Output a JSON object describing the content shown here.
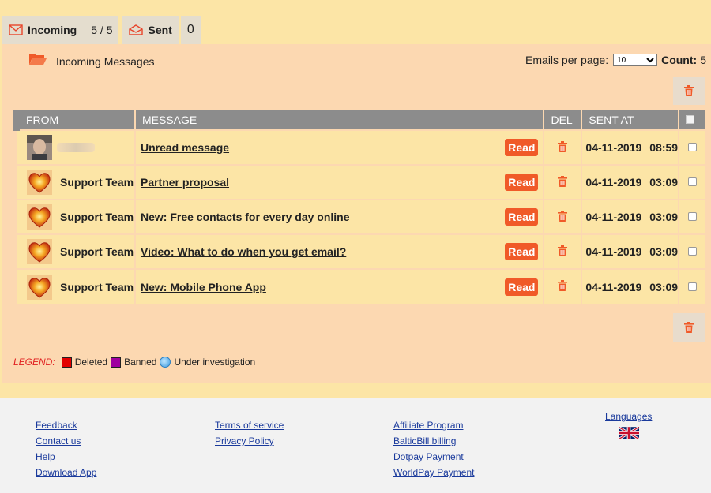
{
  "tabs": {
    "incoming": {
      "label": "Incoming",
      "count": "5 / 5"
    },
    "sent": {
      "label": "Sent",
      "count": "0"
    }
  },
  "panel": {
    "title": "Incoming Messages",
    "emails_per_page_label": "Emails per page:",
    "emails_per_page_value": "10",
    "count_label": "Count",
    "count_value": "5"
  },
  "table": {
    "headers": {
      "from": "FROM",
      "message": "MESSAGE",
      "del": "DEL",
      "sent_at": "SENT AT"
    },
    "read_label": "Read",
    "rows": [
      {
        "from": "",
        "avatar": "user-photo",
        "message": "Unread message",
        "date": "04-11-2019",
        "time": "08:59"
      },
      {
        "from": "Support Team",
        "avatar": "heart-icon",
        "message": "Partner proposal",
        "date": "04-11-2019",
        "time": "03:09"
      },
      {
        "from": "Support Team",
        "avatar": "heart-icon",
        "message": "New: Free contacts for every day online",
        "date": "04-11-2019",
        "time": "03:09"
      },
      {
        "from": "Support Team",
        "avatar": "heart-icon",
        "message": "Video: What to do when you get email?",
        "date": "04-11-2019",
        "time": "03:09"
      },
      {
        "from": "Support Team",
        "avatar": "heart-icon",
        "message": "New: Mobile Phone App",
        "date": "04-11-2019",
        "time": "03:09"
      }
    ]
  },
  "legend": {
    "title": "LEGEND",
    "deleted": "Deleted",
    "banned": "Banned",
    "investigation": "Under investigation"
  },
  "footer": {
    "col1": [
      "Feedback",
      "Contact us",
      "Help",
      "Download App"
    ],
    "col2": [
      "Terms of service",
      "Privacy Policy"
    ],
    "col3": [
      "Affiliate Program",
      "BalticBill billing",
      "Dotpay Payment",
      "WorldPay Payment"
    ],
    "languages": "Languages"
  },
  "colors": {
    "accent": "#f05a28",
    "panel": "#fcd8b1",
    "page": "#fce5a6",
    "header": "#8c8c8c",
    "link": "#1a3a9c"
  }
}
